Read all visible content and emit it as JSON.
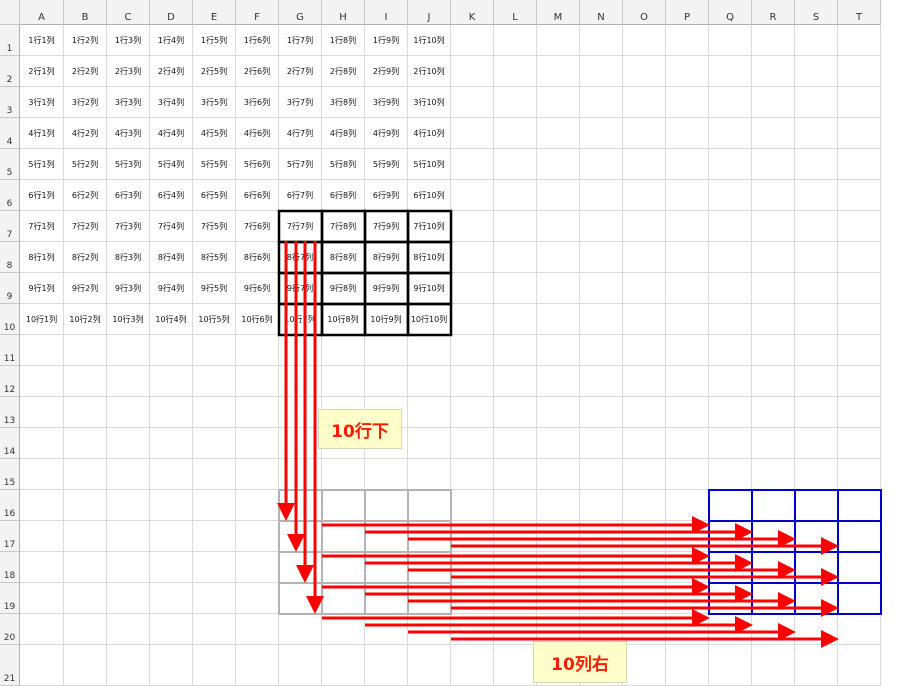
{
  "columns": [
    "A",
    "B",
    "C",
    "D",
    "E",
    "F",
    "G",
    "H",
    "I",
    "J",
    "K",
    "L",
    "M",
    "N",
    "O",
    "P",
    "Q",
    "R",
    "S",
    "T"
  ],
  "rows": [
    "1",
    "2",
    "3",
    "4",
    "5",
    "6",
    "7",
    "8",
    "9",
    "10",
    "11",
    "12",
    "13",
    "14",
    "15",
    "16",
    "17",
    "18",
    "19",
    "20",
    "21"
  ],
  "cells": [
    [
      "1行1列",
      "1行2列",
      "1行3列",
      "1行4列",
      "1行5列",
      "1行6列",
      "1行7列",
      "1行8列",
      "1行9列",
      "1行10列"
    ],
    [
      "2行1列",
      "2行2列",
      "2行3列",
      "2行4列",
      "2行5列",
      "2行6列",
      "2行7列",
      "2行8列",
      "2行9列",
      "2行10列"
    ],
    [
      "3行1列",
      "3行2列",
      "3行3列",
      "3行4列",
      "3行5列",
      "3行6列",
      "3行7列",
      "3行8列",
      "3行9列",
      "3行10列"
    ],
    [
      "4行1列",
      "4行2列",
      "4行3列",
      "4行4列",
      "4行5列",
      "4行6列",
      "4行7列",
      "4行8列",
      "4行9列",
      "4行10列"
    ],
    [
      "5行1列",
      "5行2列",
      "5行3列",
      "5行4列",
      "5行5列",
      "5行6列",
      "5行7列",
      "5行8列",
      "5行9列",
      "5行10列"
    ],
    [
      "6行1列",
      "6行2列",
      "6行3列",
      "6行4列",
      "6行5列",
      "6行6列",
      "6行7列",
      "6行8列",
      "6行9列",
      "6行10列"
    ],
    [
      "7行1列",
      "7行2列",
      "7行3列",
      "7行4列",
      "7行5列",
      "7行6列",
      "7行7列",
      "7行8列",
      "7行9列",
      "7行10列"
    ],
    [
      "8行1列",
      "8行2列",
      "8行3列",
      "8行4列",
      "8行5列",
      "8行6列",
      "8行7列",
      "8行8列",
      "8行9列",
      "8行10列"
    ],
    [
      "9行1列",
      "9行2列",
      "9行3列",
      "9行4列",
      "9行5列",
      "9行6列",
      "9行7列",
      "9行8列",
      "9行9列",
      "9行10列"
    ],
    [
      "10行1列",
      "10行2列",
      "10行3列",
      "10行4列",
      "10行5列",
      "10行6列",
      "10行7列",
      "10行8列",
      "10行9列",
      "10行10列"
    ]
  ],
  "annotations": {
    "down_label": "10行下",
    "right_label": "10列右"
  },
  "colors": {
    "arrow": "#ff0000",
    "source_border": "#000000",
    "intermediate_border": "#b4b4b4",
    "destination_border": "#0000cc",
    "note_bg": "#ffffcc"
  }
}
